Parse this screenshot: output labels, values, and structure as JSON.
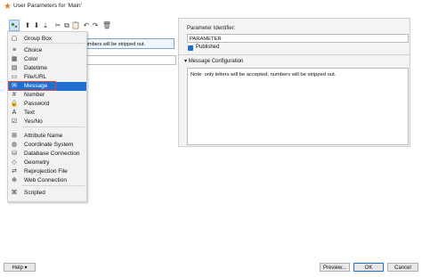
{
  "window": {
    "title": "User Parameters for 'Main'"
  },
  "left": {
    "param_row_text": "numbers will be stripped out."
  },
  "menu": {
    "items": [
      {
        "label": "Group Box",
        "icon": "group-box-icon"
      },
      {
        "label": "Choice",
        "icon": "list-icon"
      },
      {
        "label": "Color",
        "icon": "palette-icon"
      },
      {
        "label": "Datetime",
        "icon": "calendar-icon"
      },
      {
        "label": "File/URL",
        "icon": "document-icon"
      },
      {
        "label": "Message",
        "icon": "message-icon",
        "selected": true
      },
      {
        "label": "Number",
        "icon": "hash-icon"
      },
      {
        "label": "Password",
        "icon": "lock-icon"
      },
      {
        "label": "Text",
        "icon": "text-icon"
      },
      {
        "label": "Yes/No",
        "icon": "checkbox-icon"
      },
      {
        "label": "Attribute Name",
        "icon": "attribute-icon"
      },
      {
        "label": "Coordinate System",
        "icon": "globe-icon"
      },
      {
        "label": "Database Connection",
        "icon": "database-icon"
      },
      {
        "label": "Geometry",
        "icon": "geometry-icon"
      },
      {
        "label": "Reprojection File",
        "icon": "reprojection-icon"
      },
      {
        "label": "Web Connection",
        "icon": "web-icon"
      },
      {
        "label": "Scripted",
        "icon": "script-icon"
      }
    ]
  },
  "right": {
    "identifier_label": "Parameter Identifier:",
    "identifier_value": "PARAMETER",
    "published_label": "Published",
    "published_checked": true,
    "section_title": "Message Configuration",
    "message_text": "Note: only letters will be accepted, numbers will be stripped out."
  },
  "buttons": {
    "help": "Help",
    "preview": "Preview...",
    "ok": "OK",
    "cancel": "Cancel"
  }
}
